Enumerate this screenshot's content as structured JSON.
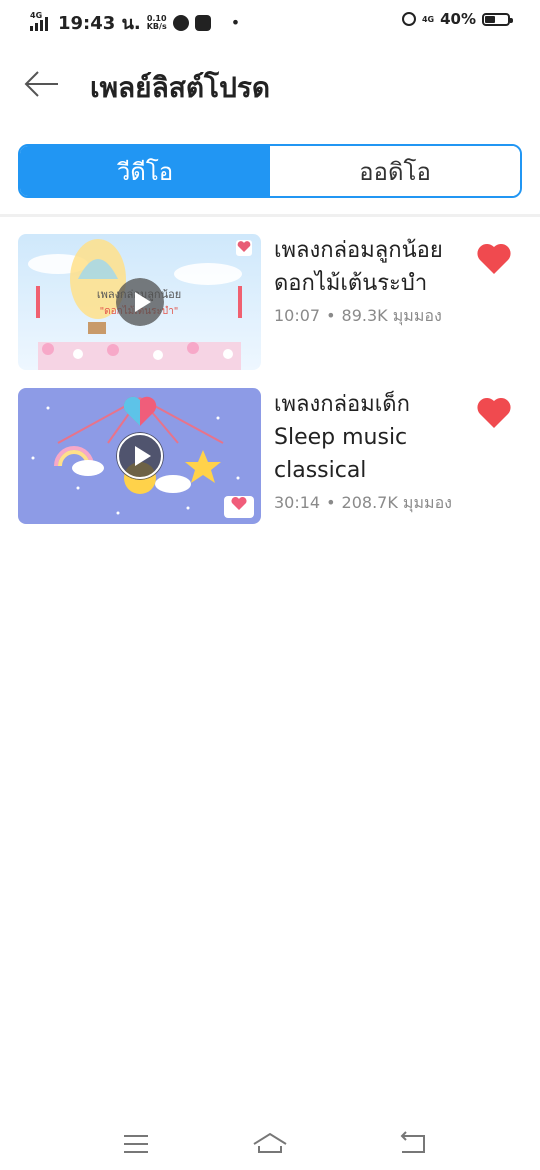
{
  "status_bar": {
    "network_tag": "4G",
    "time": "19:43 น.",
    "speed_value": "0.10",
    "speed_unit": "KB/s",
    "network_tag_right": "4G",
    "battery_percent": "40%",
    "battery_level": 0.4
  },
  "header": {
    "title": "เพลย์ลิสต์โปรด",
    "back_icon": "arrow-left-icon"
  },
  "tabs": [
    {
      "label": "วีดีโอ",
      "active": true
    },
    {
      "label": "ออดิโอ",
      "active": false
    }
  ],
  "videos": [
    {
      "title": "เพลงกล่อมลูกน้อย ดอกไม้เต้นระบำ",
      "duration": "10:07",
      "views": "89.3K มุมมอง",
      "thumbnail_caption_line1": "เพลงกล่อมลูกน้อย",
      "thumbnail_caption_line2": "\"ดอกไม้เต้นระบำ\"",
      "favorited": true
    },
    {
      "title": "เพลงกล่อมเด็ก Sleep music classical",
      "duration": "30:14",
      "views": "208.7K มุมมอง",
      "favorited": true
    }
  ],
  "colors": {
    "accent": "#2196f3",
    "heart": "#f04a4f",
    "meta_text": "#8a8a8a"
  },
  "nav": {
    "menu_icon": "menu-icon",
    "home_icon": "home-icon",
    "back_icon": "return-icon"
  }
}
